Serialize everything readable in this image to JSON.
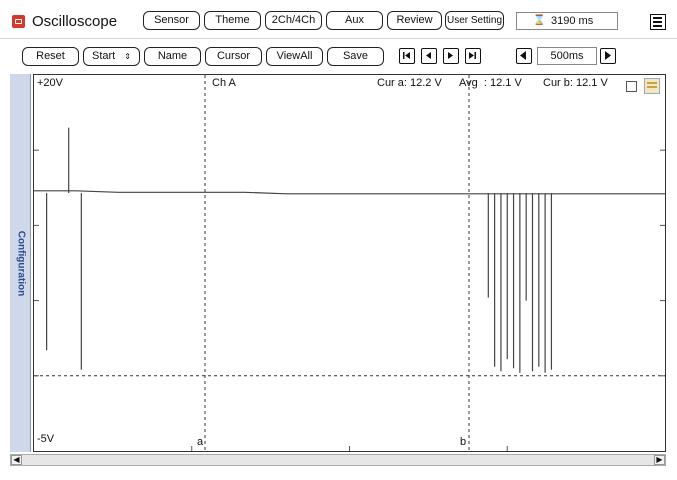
{
  "app": {
    "title": "Oscilloscope"
  },
  "toolbar1": {
    "sensor": "Sensor",
    "theme": "Theme",
    "channels": "2Ch/4Ch",
    "aux": "Aux",
    "review": "Review",
    "user_setting": "User Setting",
    "time_readout": "3190 ms"
  },
  "toolbar2": {
    "reset": "Reset",
    "start": "Start",
    "name": "Name",
    "cursor": "Cursor",
    "view_all": "ViewAll",
    "save": "Save",
    "timebase": "500ms"
  },
  "sidebar": {
    "label": "Configuration"
  },
  "plot": {
    "y_top": "+20V",
    "y_bottom": "-5V",
    "channel": "Ch A",
    "cur_a": "Cur a: 12.2 V",
    "avg": "Avg  : 12.1 V",
    "cur_b": "Cur b: 12.1 V",
    "cursor_a_label": "a",
    "cursor_b_label": "b"
  },
  "chart_data": {
    "type": "line",
    "ylim": [
      -5,
      20
    ],
    "grid": "dashed",
    "series": [
      {
        "values": [
          12.3,
          12.3,
          12.2,
          12.2,
          12.2,
          12.2,
          12.1,
          12.1,
          12.1,
          12.1,
          12.1,
          12.1,
          12.1,
          12.1,
          12.1,
          12.1
        ]
      }
    ],
    "spikes": [
      {
        "t": 0.02,
        "y": 1.7
      },
      {
        "t": 0.055,
        "y": 16.5
      },
      {
        "t": 0.075,
        "y": 0.4
      },
      {
        "t": 0.72,
        "y": 5.2
      },
      {
        "t": 0.73,
        "y": 0.6
      },
      {
        "t": 0.74,
        "y": 0.3
      },
      {
        "t": 0.75,
        "y": 1.1
      },
      {
        "t": 0.76,
        "y": 0.5
      },
      {
        "t": 0.77,
        "y": 0.2
      },
      {
        "t": 0.78,
        "y": 5.0
      },
      {
        "t": 0.79,
        "y": 0.3
      },
      {
        "t": 0.8,
        "y": 0.6
      },
      {
        "t": 0.81,
        "y": 0.2
      },
      {
        "t": 0.82,
        "y": 0.4
      }
    ]
  }
}
